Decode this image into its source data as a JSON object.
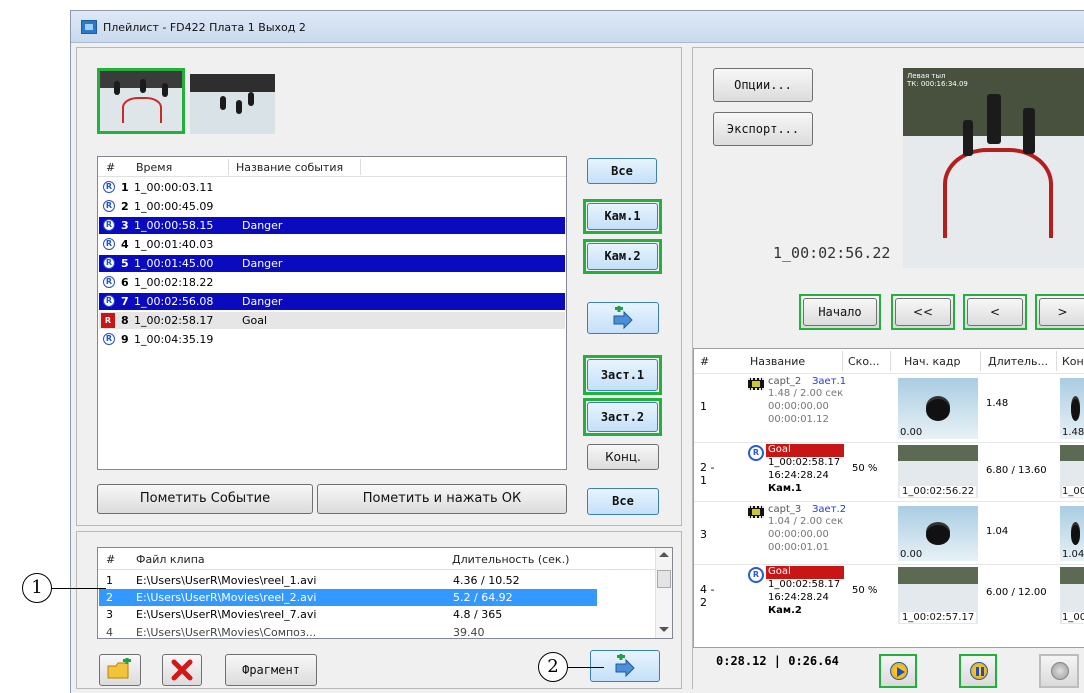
{
  "window": {
    "title": "Плейлист - FD422 Плата 1 Выход 2"
  },
  "events": {
    "columns": [
      "#",
      "Время",
      "Название события"
    ],
    "rows": [
      {
        "num": "1",
        "time": "1_00:00:03.11",
        "name": "",
        "state": "normal"
      },
      {
        "num": "2",
        "time": "1_00:00:45.09",
        "name": "",
        "state": "normal"
      },
      {
        "num": "3",
        "time": "1_00:00:58.15",
        "name": "Danger",
        "state": "highlight"
      },
      {
        "num": "4",
        "time": "1_00:01:40.03",
        "name": "",
        "state": "normal"
      },
      {
        "num": "5",
        "time": "1_00:01:45.00",
        "name": "Danger",
        "state": "highlight"
      },
      {
        "num": "6",
        "time": "1_00:02:18.22",
        "name": "",
        "state": "normal"
      },
      {
        "num": "7",
        "time": "1_00:02:56.08",
        "name": "Danger",
        "state": "highlight"
      },
      {
        "num": "8",
        "time": "1_00:02:58.17",
        "name": "Goal",
        "state": "goal"
      },
      {
        "num": "9",
        "time": "1_00:04:35.19",
        "name": "",
        "state": "normal"
      }
    ],
    "icon_letter": "R"
  },
  "side_buttons": {
    "all_top": "Все",
    "cam1": "Кам.1",
    "cam2": "Кам.2",
    "zast1": "Заст.1",
    "zast2": "Заст.2",
    "konc": "Конц.",
    "all_bottom": "Все"
  },
  "mark_buttons": {
    "mark_event": "Пометить Событие",
    "mark_ok": "Пометить и нажать ОК"
  },
  "files": {
    "columns": [
      "#",
      "Файл клипа",
      "Длительность (сек.)"
    ],
    "rows": [
      {
        "num": "1",
        "file": "E:\\Users\\UserR\\Movies\\reel_1.avi",
        "dur": "4.36 / 10.52",
        "selected": false
      },
      {
        "num": "2",
        "file": "E:\\Users\\UserR\\Movies\\reel_2.avi",
        "dur": "5.2 / 64.92",
        "selected": true
      },
      {
        "num": "3",
        "file": "E:\\Users\\UserR\\Movies\\reel_7.avi",
        "dur": "4.8 / 365",
        "selected": false
      }
    ]
  },
  "bottom_buttons": {
    "fragment": "Фрагмент"
  },
  "right": {
    "options": "Опции...",
    "export": "Экспорт...",
    "timecode": "1_00:02:56.22",
    "preview_overlay_1": "Левая тыл",
    "preview_overlay_2": "ТК: 000:16:34.09",
    "nav": {
      "start": "Начало",
      "rewind": "<<",
      "prev": "<",
      "next": ">"
    },
    "status_time": "0:28.12 | 0:26.64"
  },
  "playlist": {
    "columns": [
      "#",
      "Название",
      "Ско...",
      "Нач. кадр",
      "Длитель...",
      "Кон."
    ],
    "rows": [
      {
        "num": "1",
        "type": "film",
        "name": "capt_2",
        "tag": "Зает.1",
        "line2": "1.48 / 2.00 сек",
        "line3": "00:00:00.00",
        "line4": "00:00:01.12",
        "speed": "",
        "frame_caption": "0.00",
        "dur": "1.48",
        "end_caption": "1.48"
      },
      {
        "num": "2 - 1",
        "type": "event",
        "name": "Goal",
        "tag": "",
        "line2": "1_00:02:58.17",
        "line3": "16:24:28.24",
        "line4": "Кам.1",
        "speed": "50 %",
        "frame_caption": "1_00:02:56.22",
        "dur": "6.80 / 13.60",
        "end_caption": "1_00:"
      },
      {
        "num": "3",
        "type": "film",
        "name": "capt_3",
        "tag": "Зает.2",
        "line2": "1.04 / 2.00 сек",
        "line3": "00:00:00.00",
        "line4": "00:00:01.01",
        "speed": "",
        "frame_caption": "0.00",
        "dur": "1.04",
        "end_caption": "1.04"
      },
      {
        "num": "4 - 2",
        "type": "event",
        "name": "Goal",
        "tag": "",
        "line2": "1_00:02:58.17",
        "line3": "16:24:28.24",
        "line4": "Кам.2",
        "speed": "50 %",
        "frame_caption": "1_00:02:57.17",
        "dur": "6.00 / 12.00",
        "end_caption": "1_00:"
      }
    ]
  },
  "callouts": {
    "c1": "1",
    "c2": "2"
  },
  "colors": {
    "selection_green": "#22b13a",
    "highlight_blue": "#0a0abf",
    "goal_red": "#c81616",
    "file_selected": "#3399ff"
  }
}
